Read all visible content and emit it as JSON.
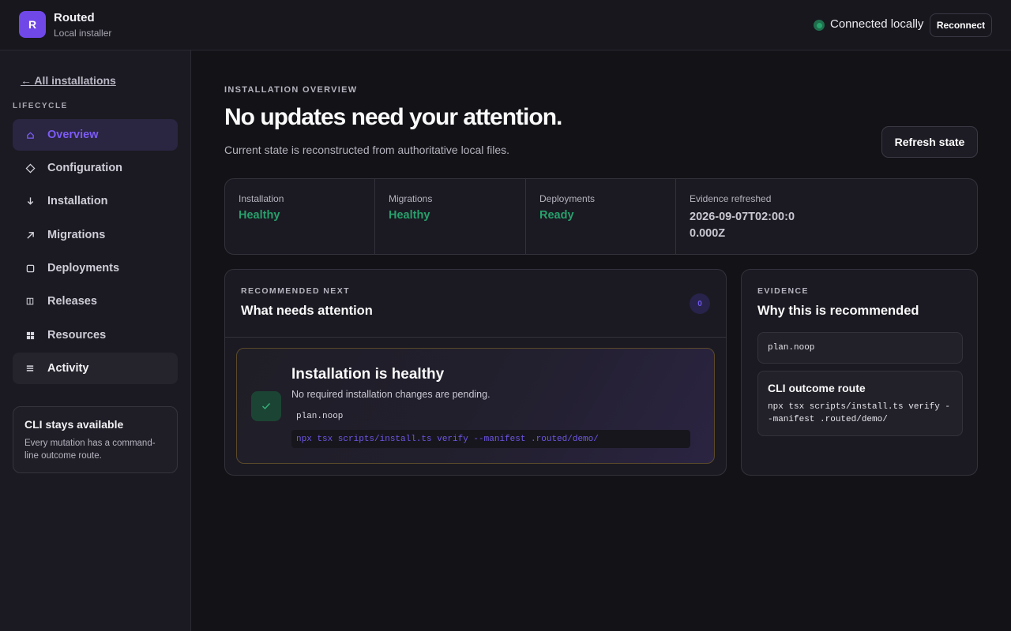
{
  "app": {
    "logo_letter": "R",
    "name": "Routed",
    "subtitle": "Local installer"
  },
  "connection": {
    "status": "Connected locally",
    "status_color": "#28a26c",
    "reconnect_label": "Reconnect"
  },
  "sidebar": {
    "back_label": "← All installations",
    "section_label": "LIFECYCLE",
    "items": [
      {
        "label": "Overview",
        "icon": "home-icon",
        "state": "active"
      },
      {
        "label": "Configuration",
        "icon": "diamond-icon",
        "state": ""
      },
      {
        "label": "Installation",
        "icon": "arrow-down-icon",
        "state": ""
      },
      {
        "label": "Migrations",
        "icon": "arrow-up-right-icon",
        "state": ""
      },
      {
        "label": "Deployments",
        "icon": "square-icon",
        "state": ""
      },
      {
        "label": "Releases",
        "icon": "columns-icon",
        "state": ""
      },
      {
        "label": "Resources",
        "icon": "grid-icon",
        "state": ""
      },
      {
        "label": "Activity",
        "icon": "list-icon",
        "state": "hover"
      }
    ],
    "cli_card": {
      "title": "CLI stays available",
      "body": "Every mutation has a command-line outcome route."
    }
  },
  "overview": {
    "eyebrow": "INSTALLATION OVERVIEW",
    "title": "No updates need your attention.",
    "subtitle": "Current state is reconstructed from authoritative local files.",
    "refresh_label": "Refresh state",
    "stats": [
      {
        "label": "Installation",
        "value": "Healthy"
      },
      {
        "label": "Migrations",
        "value": "Healthy"
      },
      {
        "label": "Deployments",
        "value": "Ready"
      },
      {
        "label": "Evidence refreshed",
        "value": "2026-09-07T02:00:00.000Z"
      }
    ]
  },
  "recommended": {
    "eyebrow": "RECOMMENDED NEXT",
    "title": "What needs attention",
    "count": "0",
    "item": {
      "title": "Installation is healthy",
      "subtitle": "No required installation changes are pending.",
      "plan": "plan.noop",
      "command": "npx tsx scripts/install.ts verify --manifest .routed/demo/"
    }
  },
  "evidence": {
    "eyebrow": "EVIDENCE",
    "title": "Why this is recommended",
    "plan": "plan.noop",
    "route_title": "CLI outcome route",
    "route_command": "npx tsx scripts/install.ts verify --manifest .routed/demo/"
  },
  "colors": {
    "accent": "#7048e8",
    "healthy": "#27a06c",
    "background": "#131217"
  }
}
